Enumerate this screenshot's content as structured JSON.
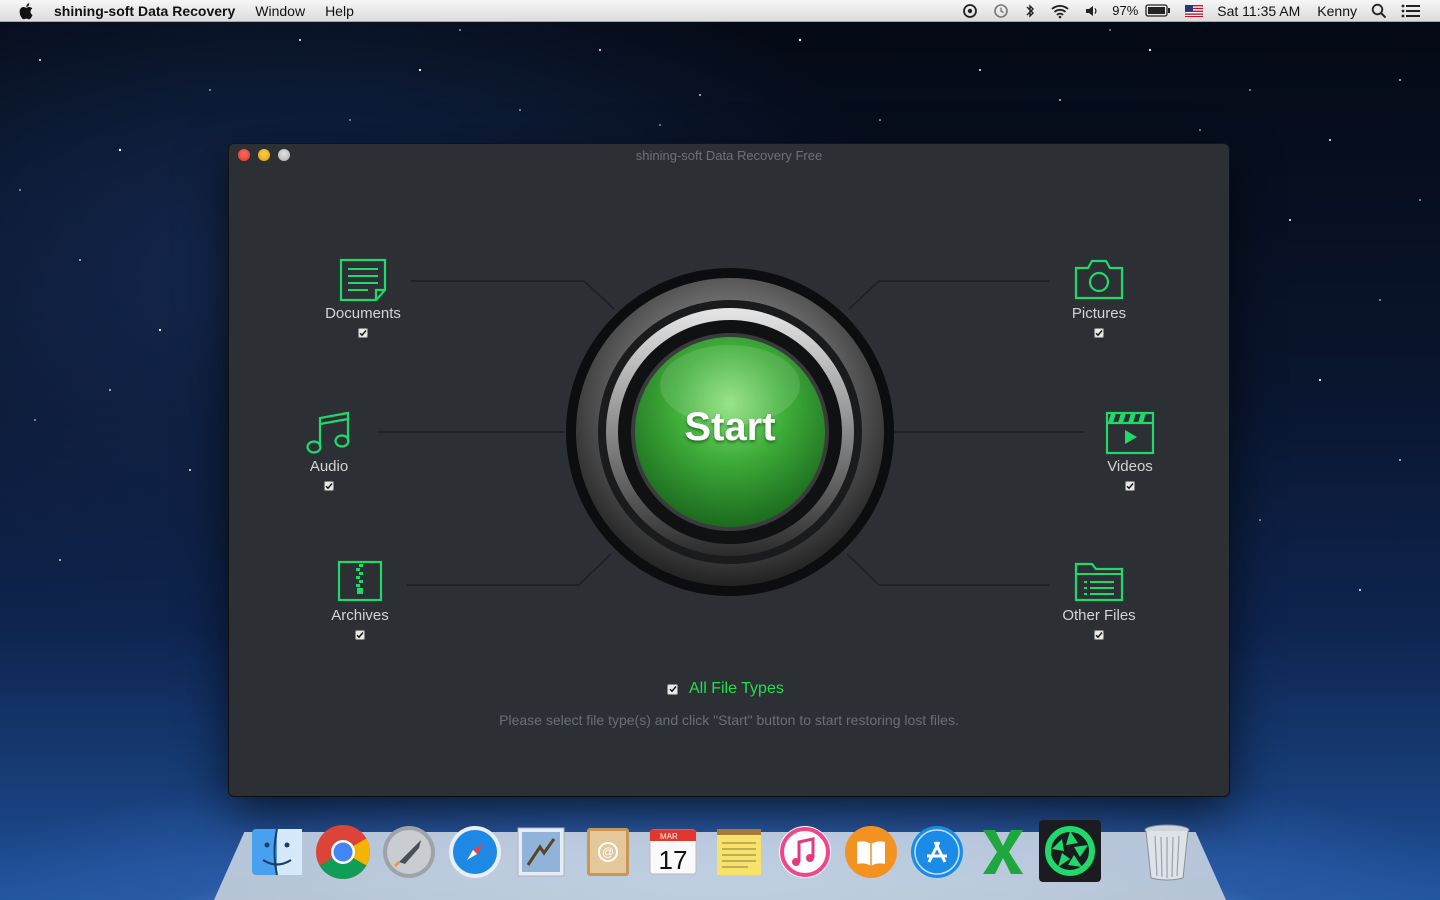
{
  "menubar": {
    "app_name": "shining-soft Data Recovery",
    "menus": [
      "Window",
      "Help"
    ],
    "battery": "97%",
    "clock": "Sat 11:35 AM",
    "user": "Kenny"
  },
  "window": {
    "title": "shining-soft Data Recovery Free",
    "start_label": "Start",
    "file_types": [
      {
        "label": "Documents",
        "checked": true
      },
      {
        "label": "Audio",
        "checked": true
      },
      {
        "label": "Archives",
        "checked": true
      },
      {
        "label": "Pictures",
        "checked": true
      },
      {
        "label": "Videos",
        "checked": true
      },
      {
        "label": "Other Files",
        "checked": true
      }
    ],
    "all_file_types": {
      "label": "All File Types",
      "checked": true
    },
    "hint": "Please select file type(s) and click \"Start\" button to start restoring lost files."
  },
  "colors": {
    "accent_green": "#22e04a",
    "icon_green": "#1fd96a",
    "window_bg": "#2c2f34",
    "start_green": "#3fae3a"
  },
  "dock": {
    "icons": [
      "finder-icon",
      "chrome-icon",
      "launchpad-icon",
      "safari-icon",
      "mail-icon",
      "contacts-icon",
      "calendar-icon",
      "notes-icon",
      "itunes-icon",
      "ibooks-icon",
      "app-store-icon",
      "excel-icon",
      "data-recovery-icon",
      "trash-icon"
    ],
    "calendar_month": "MAR",
    "calendar_day": "17"
  }
}
